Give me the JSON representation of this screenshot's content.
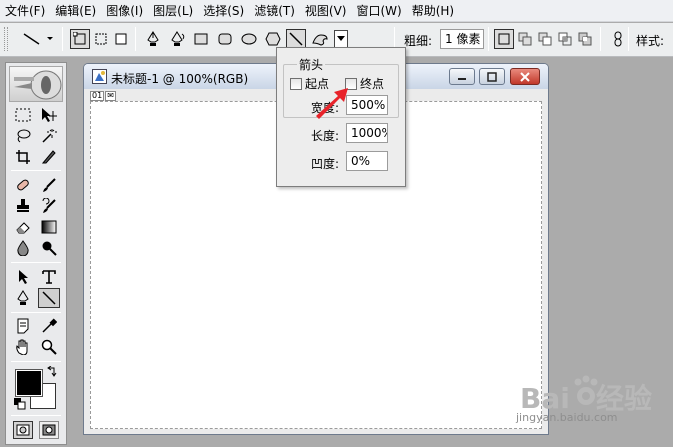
{
  "menu": [
    "文件(F)",
    "编辑(E)",
    "图像(I)",
    "图层(L)",
    "选择(S)",
    "滤镜(T)",
    "视图(V)",
    "窗口(W)",
    "帮助(H)"
  ],
  "options_bar": {
    "weight_label": "粗细:",
    "weight_value": "1 像素",
    "style_label": "样式:"
  },
  "document": {
    "title": "未标题-1 @ 100%(RGB)",
    "status_tags": [
      "01",
      "✉"
    ]
  },
  "arrow_popup": {
    "legend": "箭头",
    "start_label": "起点",
    "start_checked": false,
    "end_label": "终点",
    "end_checked": false,
    "width_label": "宽度:",
    "width_value": "500%",
    "length_label": "长度:",
    "length_value": "1000%",
    "concavity_label": "凹度:",
    "concavity_value": "0%"
  },
  "colors": {
    "foreground": "#000000",
    "background": "#ffffff",
    "annotation_arrow": "#e8232a"
  },
  "watermark": {
    "text": "jingyan.baidu.com"
  }
}
